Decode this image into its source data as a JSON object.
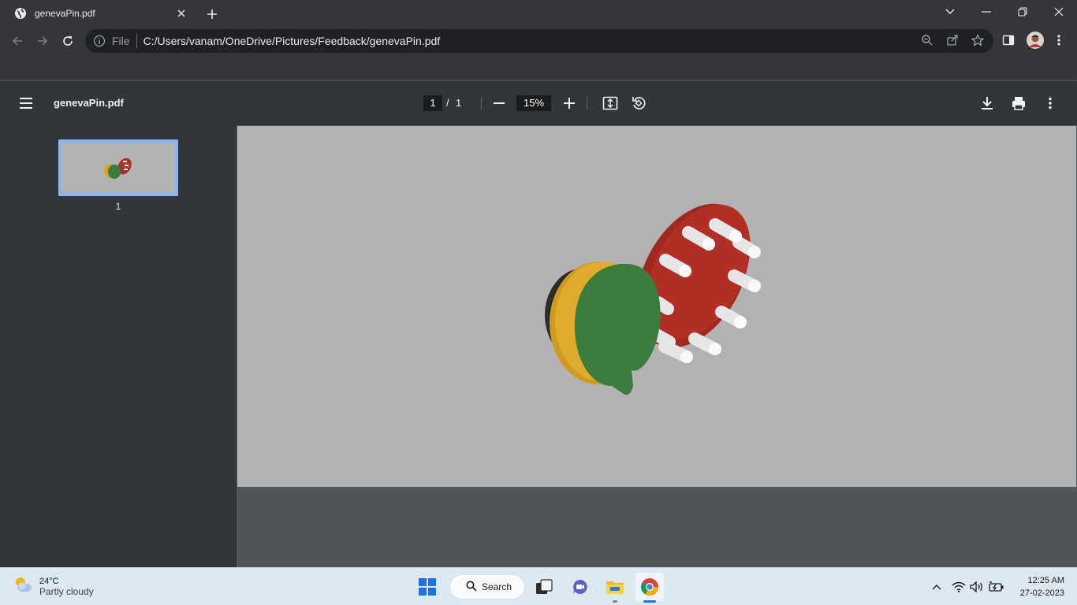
{
  "browser": {
    "tab_title": "genevaPin.pdf",
    "omnibox_scheme_label": "File",
    "url": "C:/Users/vanam/OneDrive/Pictures/Feedback/genevaPin.pdf"
  },
  "pdf_toolbar": {
    "file_name": "genevaPin.pdf",
    "current_page": "1",
    "page_separator": "/",
    "total_pages": "1",
    "zoom": "15%"
  },
  "sidebar": {
    "thumbnail_label": "1"
  },
  "taskbar": {
    "temperature": "24°C",
    "weather_condition": "Partly cloudy",
    "search_label": "Search",
    "time": "12:25 AM",
    "date": "27-02-2023"
  }
}
